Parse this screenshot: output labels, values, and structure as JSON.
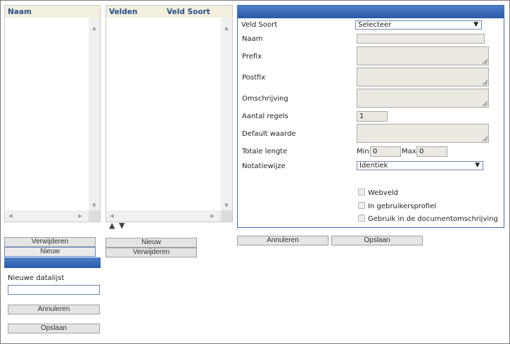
{
  "naam_panel": {
    "header": "Naam"
  },
  "velden_panel": {
    "header_velden": "Velden",
    "header_soort": "Veld Soort"
  },
  "left_buttons": {
    "remove": "Verwijderen",
    "new": "Nieuw"
  },
  "mid_buttons": {
    "new": "Nieuw",
    "remove": "Verwijderen"
  },
  "move_arrows": {
    "up": "▲",
    "down": "▼"
  },
  "new_list": {
    "label": "Nieuwe datalijst",
    "value": "",
    "cancel": "Annuleren",
    "save": "Opslaan"
  },
  "form": {
    "veld_soort_label": "Veld Soort",
    "veld_soort_value": "Selecteer",
    "naam_label": "Naam",
    "prefix_label": "Prefix",
    "postfix_label": "Postfix",
    "omschrijving_label": "Omschrijving",
    "aantal_regels_label": "Aantal regels",
    "aantal_regels_value": "1",
    "default_waarde_label": "Default waarde",
    "totale_lengte_label": "Totale lengte",
    "min_label": "Min.",
    "min_value": "0",
    "max_label": "Max.",
    "max_value": "0",
    "notatiewijze_label": "Notatiewijze",
    "notatiewijze_value": "Identiek",
    "webveld_label": "Webveld",
    "gebruikersprofiel_label": "In gebruikersprofiel",
    "documentomschrijving_label": "Gebruik in de documentomschrijving"
  },
  "form_buttons": {
    "cancel": "Annuleren",
    "save": "Opslaan"
  }
}
